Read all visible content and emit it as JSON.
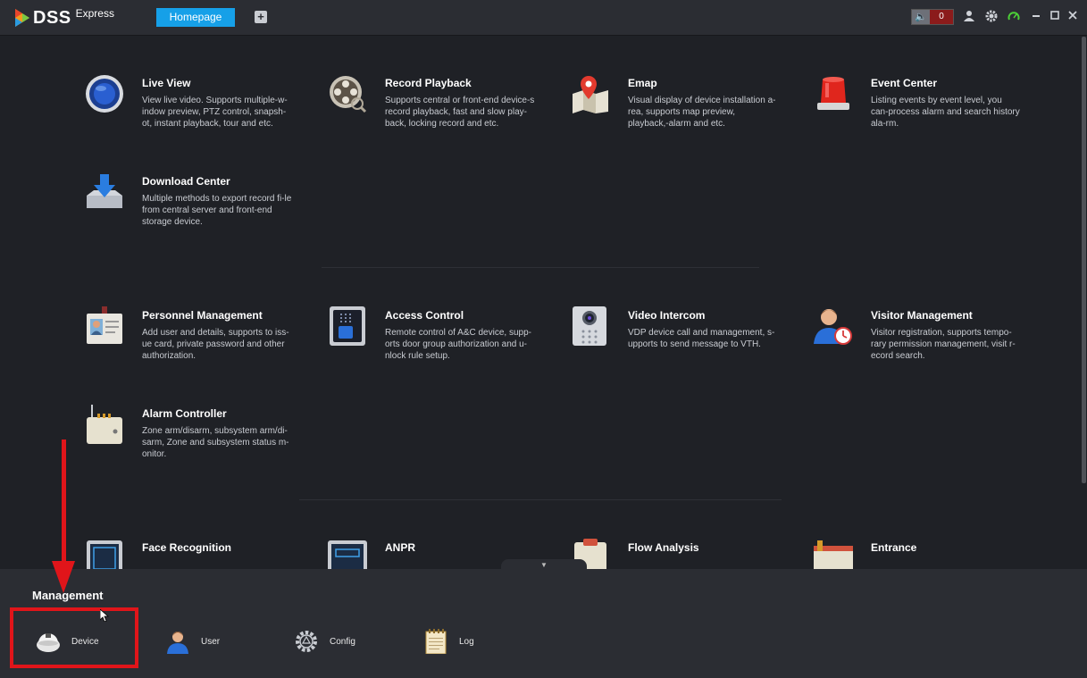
{
  "titlebar": {
    "logo_text": "DSS",
    "logo_sub": "Express",
    "tab_home": "Homepage",
    "add_tab": "+",
    "alarm_count": "0"
  },
  "modules": [
    {
      "title": "Live View",
      "desc": "View live video. Supports multiple-w-indow preview, PTZ control, snapsh-ot, instant playback, tour and etc.",
      "icon": "live-view-icon"
    },
    {
      "title": "Record Playback",
      "desc": "Supports central or front-end device-s record playback, fast and slow play-back, locking record and etc.",
      "icon": "record-playback-icon"
    },
    {
      "title": "Emap",
      "desc": "Visual display of device installation a-rea, supports map preview, playback,-alarm and etc.",
      "icon": "emap-icon"
    },
    {
      "title": "Event Center",
      "desc": "Listing events by event level, you can-process alarm and search history ala-rm.",
      "icon": "event-center-icon"
    },
    {
      "title": "Download Center",
      "desc": "Multiple methods to export record fi-le from central server and front-end storage device.",
      "icon": "download-center-icon"
    },
    {
      "title": "Personnel Management",
      "desc": "Add user and details, supports to iss-ue card, private password and other authorization.",
      "icon": "personnel-management-icon"
    },
    {
      "title": "Access Control",
      "desc": "Remote control of A&C device, supp-orts door group authorization and u-nlock rule setup.",
      "icon": "access-control-icon"
    },
    {
      "title": "Video Intercom",
      "desc": "VDP device call and management, s-upports to send message to VTH.",
      "icon": "video-intercom-icon"
    },
    {
      "title": "Visitor Management",
      "desc": "Visitor registration, supports tempo-rary permission management, visit r-ecord search.",
      "icon": "visitor-management-icon"
    },
    {
      "title": "Alarm Controller",
      "desc": "Zone arm/disarm, subsystem arm/di-sarm, Zone and subsystem status m-onitor.",
      "icon": "alarm-controller-icon"
    },
    {
      "title": "Face Recognition",
      "desc": "",
      "icon": "face-recognition-icon"
    },
    {
      "title": "ANPR",
      "desc": "",
      "icon": "anpr-icon"
    },
    {
      "title": "Flow Analysis",
      "desc": "",
      "icon": "flow-analysis-icon"
    },
    {
      "title": "Entrance",
      "desc": "",
      "icon": "entrance-icon"
    }
  ],
  "management": {
    "title": "Management",
    "items": [
      {
        "label": "Device",
        "icon": "device-icon"
      },
      {
        "label": "User",
        "icon": "user-icon"
      },
      {
        "label": "Config",
        "icon": "config-gear-icon"
      },
      {
        "label": "Log",
        "icon": "log-notepad-icon"
      }
    ]
  },
  "colors": {
    "accent": "#16a0e8",
    "annotation": "#e0151a",
    "background": "#1f2126",
    "panel": "#2b2d33"
  }
}
